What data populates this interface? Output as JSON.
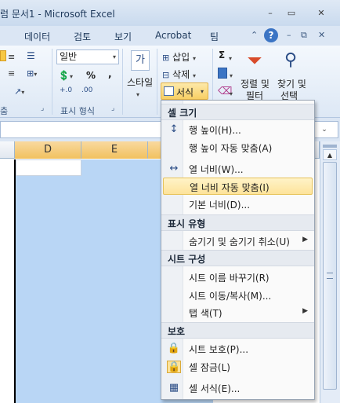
{
  "window": {
    "title": "럼 문서1 - Microsoft Excel",
    "minimize": "–",
    "restore": "▭",
    "close": "✕"
  },
  "tabs": [
    "데이터",
    "검토",
    "보기",
    "Acrobat",
    "팀"
  ],
  "tab_icons": {
    "collapse": "⌃",
    "help": "?",
    "min": "–",
    "restore": "⧉",
    "close": "✕"
  },
  "ribbon": {
    "number_format": "일반",
    "percent": "%",
    "comma": ",",
    "style_label": "스타일",
    "insert_label": "삽입",
    "delete_label": "삭제",
    "format_label": "서식",
    "sigma": "Σ",
    "sort_filter": [
      "정렬 및",
      "필터"
    ],
    "find_select": [
      "찾기 및",
      "선택"
    ],
    "group_left": "춤",
    "group_number": "표시 형식"
  },
  "columns": [
    "D",
    "E"
  ],
  "menu": {
    "sections": [
      {
        "header": "셀 크기",
        "items": [
          {
            "label": "행 높이(H)...",
            "icon": "row-height-icon",
            "glyph": "↕"
          },
          {
            "label": "행 높이 자동 맞춤(A)",
            "icon": "",
            "glyph": ""
          },
          {
            "label": "열 너비(W)...",
            "icon": "column-width-icon",
            "glyph": "↔"
          },
          {
            "label": "열 너비 자동 맞춤(I)",
            "icon": "",
            "glyph": "",
            "highlighted": true
          },
          {
            "label": "기본 너비(D)...",
            "icon": "",
            "glyph": ""
          }
        ]
      },
      {
        "header": "표시 유형",
        "items": [
          {
            "label": "숨기기 및 숨기기 취소(U)",
            "submenu": true
          }
        ]
      },
      {
        "header": "시트 구성",
        "items": [
          {
            "label": "시트 이름 바꾸기(R)"
          },
          {
            "label": "시트 이동/복사(M)..."
          },
          {
            "label": "탭 색(T)",
            "submenu": true
          }
        ]
      },
      {
        "header": "보호",
        "items": [
          {
            "label": "시트 보호(P)...",
            "icon": "protect-sheet-icon",
            "glyph": "🔒"
          },
          {
            "label": "셀 잠금(L)",
            "icon": "lock-cell-icon",
            "glyph": "🔒"
          },
          {
            "label": "셀 서식(E)...",
            "icon": "format-cells-icon",
            "glyph": "▦"
          }
        ]
      }
    ]
  }
}
